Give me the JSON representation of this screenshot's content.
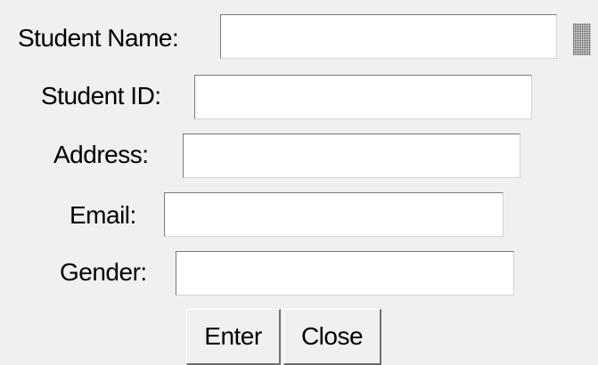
{
  "form": {
    "fields": [
      {
        "label": "Student Name:",
        "value": ""
      },
      {
        "label": "Student ID:",
        "value": ""
      },
      {
        "label": "Address:",
        "value": ""
      },
      {
        "label": "Email:",
        "value": ""
      },
      {
        "label": "Gender:",
        "value": ""
      }
    ],
    "buttons": {
      "enter": "Enter",
      "close": "Close"
    }
  },
  "icons": {
    "grip": "resize-grip-icon"
  }
}
